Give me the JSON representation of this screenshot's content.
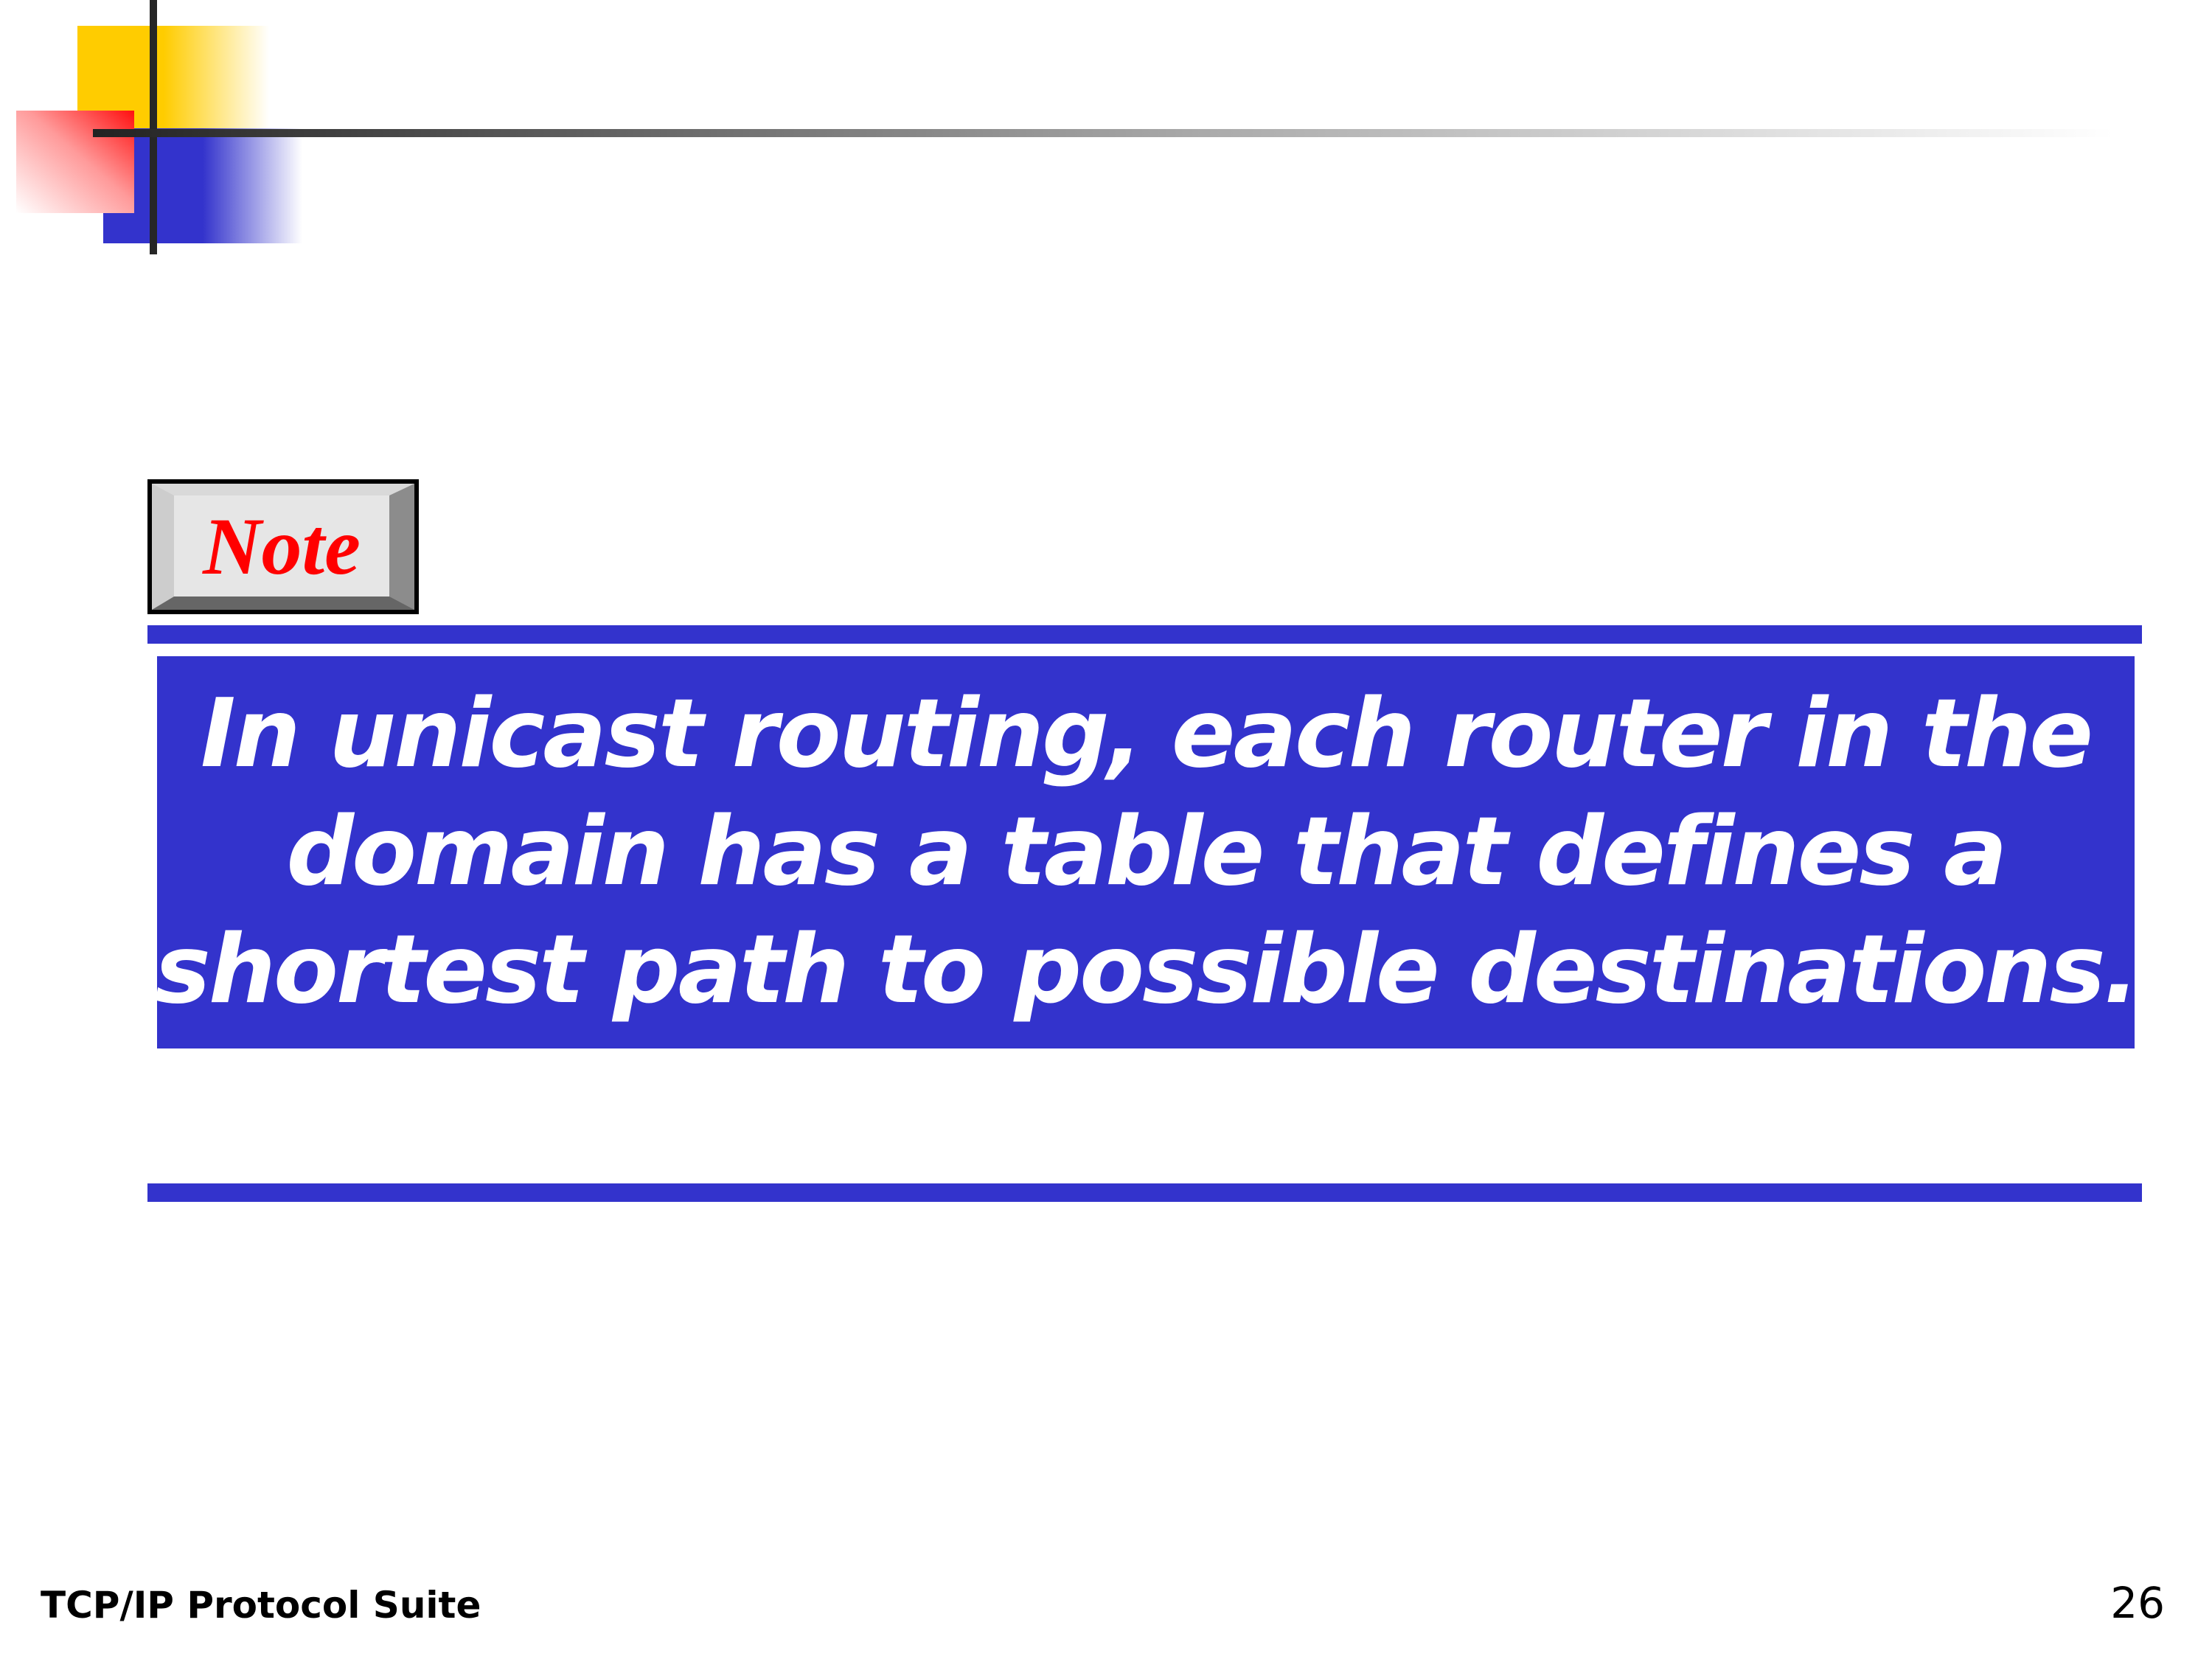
{
  "note": {
    "label": "Note"
  },
  "body": {
    "lines": [
      "In unicast routing, each router in the",
      "domain has a table that defines a",
      "shortest path to possible destinations."
    ]
  },
  "footer": {
    "title": "TCP/IP Protocol Suite",
    "page_number": "26"
  },
  "colors": {
    "accent_blue": "#3333cc",
    "note_red": "#ff0000",
    "yellow": "#ffcc00"
  }
}
